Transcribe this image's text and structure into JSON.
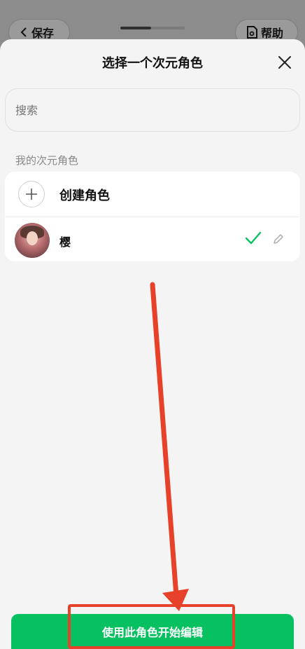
{
  "background": {
    "save_label": "保存",
    "help_label": "帮助"
  },
  "sheet": {
    "title": "选择一个次元角色",
    "search_placeholder": "搜索",
    "section_label": "我的次元角色",
    "create_label": "创建角色",
    "characters": [
      {
        "name": "樱",
        "selected": true
      }
    ]
  },
  "footer": {
    "primary_button": "使用此角色开始编辑"
  },
  "colors": {
    "accent": "#07c160",
    "annotation": "#e8412a"
  }
}
